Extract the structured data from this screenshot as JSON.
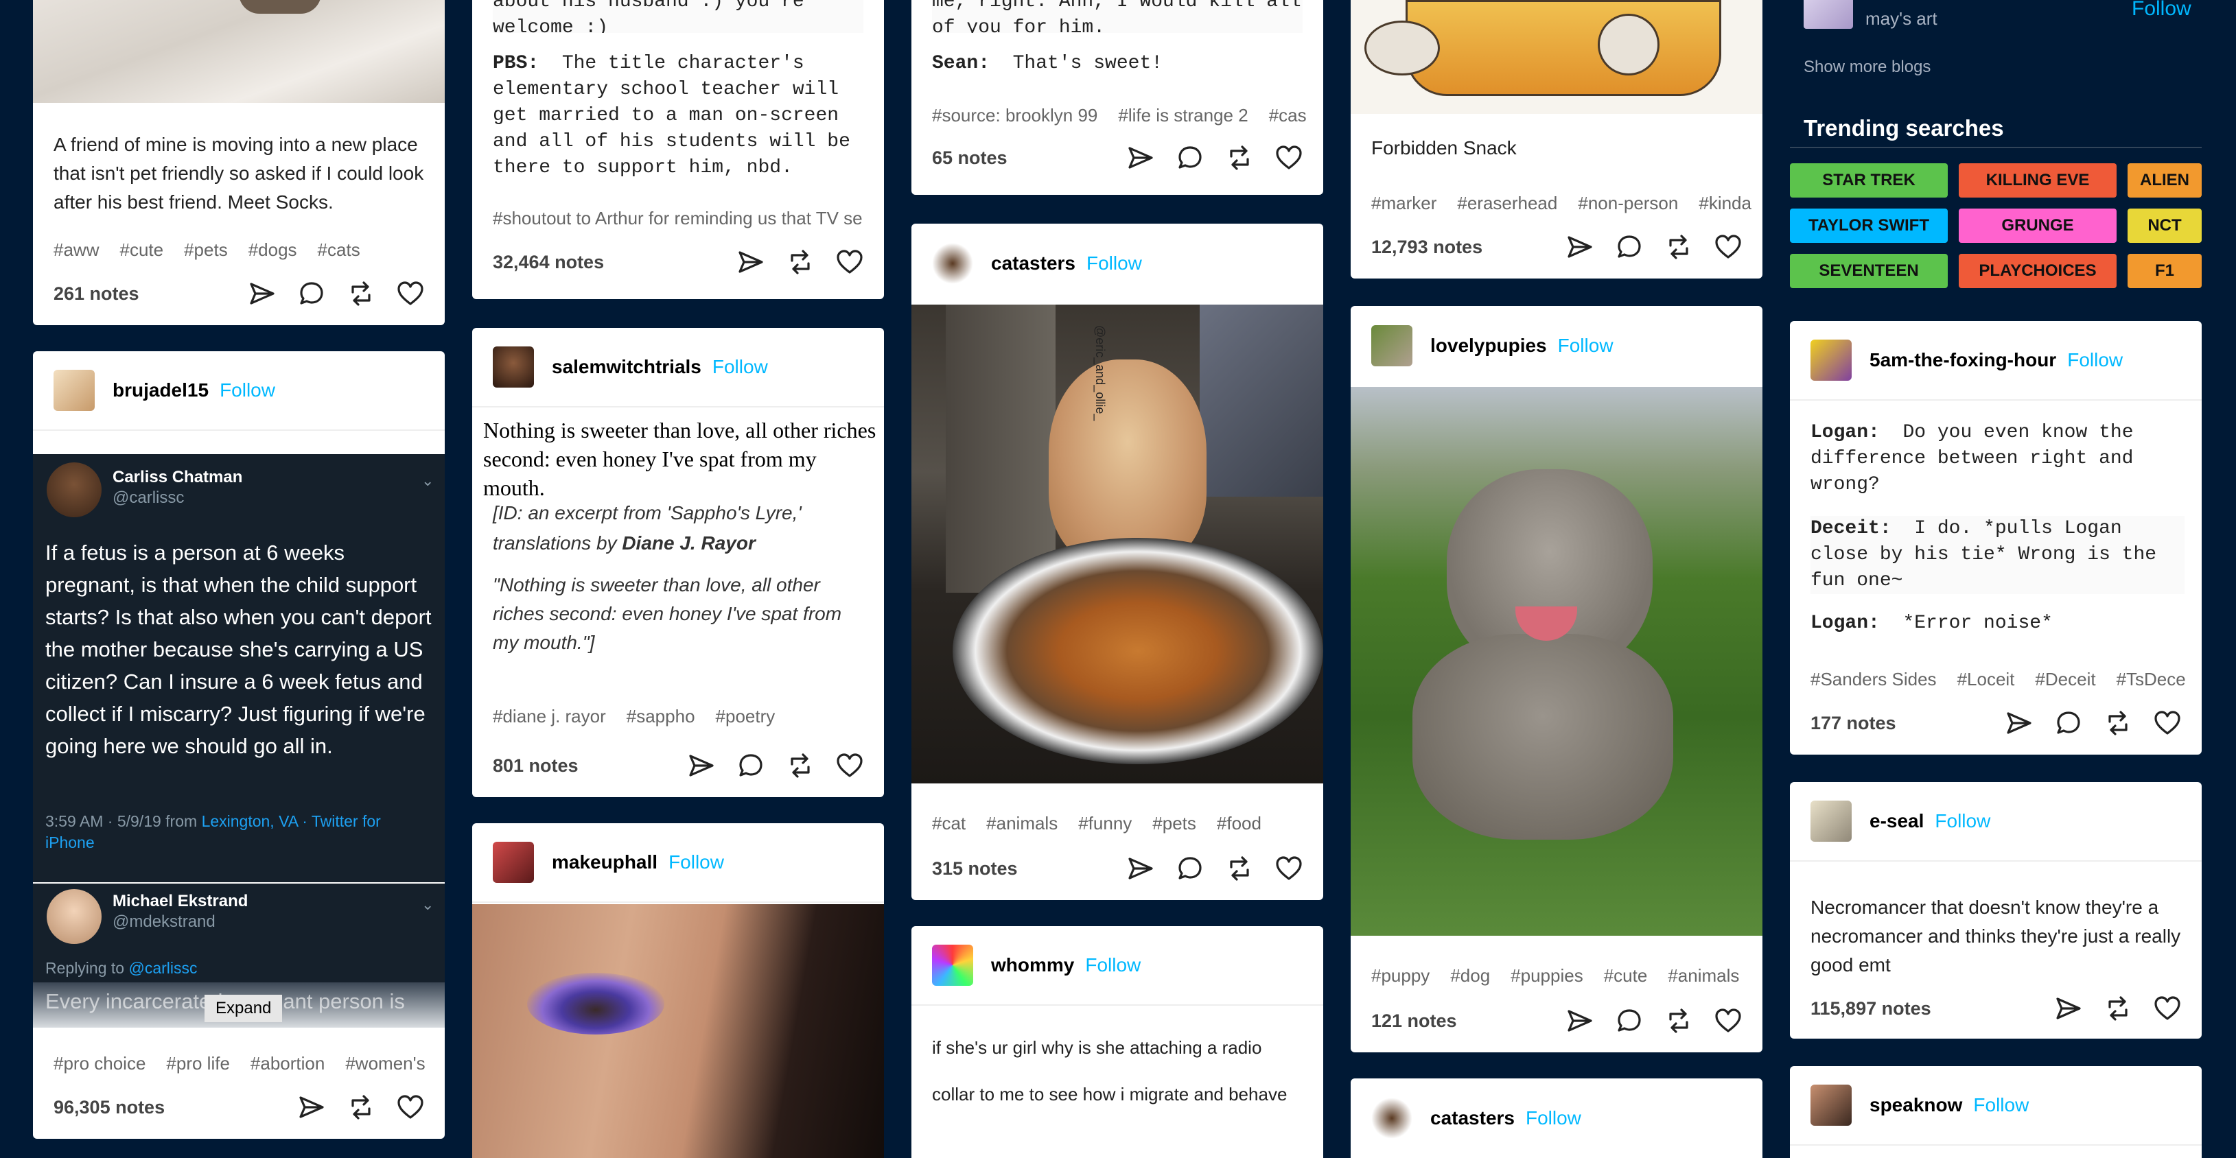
{
  "posts": {
    "socks": {
      "text": "A friend of mine is moving into a new place that isn't pet friendly so asked if I could look after his best friend. Meet Socks.",
      "tags": [
        "#aww",
        "#cute",
        "#pets",
        "#dogs",
        "#cats"
      ],
      "notes": "261 notes"
    },
    "brujadel": {
      "blog": "brujadel15",
      "follow": "Follow",
      "tweet1_name": "Carliss Chatman",
      "tweet1_handle": "@carlissc",
      "tweet1_text": "If a fetus is a person at 6 weeks pregnant, is that when the child support starts? Is that also when you can't deport the mother because she's carrying a US citizen? Can I insure a 6 week fetus and collect if I miscarry? Just figuring if we're going here we should go all in.",
      "tweet1_meta": "3:59 AM · 5/9/19 from",
      "tweet1_location": "Lexington, VA · Twitter for iPhone",
      "tweet2_name": "Michael Ekstrand",
      "tweet2_handle": "@mdekstrand",
      "replying": "Replying to",
      "replying_handle": "@carlissc",
      "tweet2_text": "Every incarcerated pregnant person is",
      "expand": "Expand",
      "tags": [
        "#pro choice",
        "#pro life",
        "#abortion",
        "#women's"
      ],
      "notes": "96,305 notes"
    },
    "pbs": {
      "top_text": "about his husband :) you're welcome :)",
      "label": "PBS:",
      "text": "The title character's elementary school teacher will get married to a man on-screen and all of his students will be there to support him, nbd.",
      "tags": [
        "#shoutout to Arthur for reminding us that TV se"
      ],
      "notes": "32,464 notes"
    },
    "salem": {
      "blog": "salemwitchtrials",
      "follow": "Follow",
      "poem": "Nothing is sweeter than love, all other riches second: even honey I've spat from my mouth.",
      "id_line": "[ID: an excerpt from 'Sappho's Lyre,' translations by",
      "id_author": "Diane J. Rayor",
      "quote": "\"Nothing is sweeter than love, all other riches second: even honey I've spat from my mouth.\"]",
      "tags": [
        "#diane j. rayor",
        "#sappho",
        "#poetry"
      ],
      "notes": "801 notes"
    },
    "makeup": {
      "blog": "makeuphall",
      "follow": "Follow"
    },
    "sean": {
      "top_text": "me, right. Ahh, I would kill all of you for him.",
      "label": "Sean:",
      "text": "That's sweet!",
      "tags": [
        "#source: brooklyn 99",
        "#life is strange 2",
        "#cas"
      ],
      "notes": "65 notes"
    },
    "catasters": {
      "blog": "catasters",
      "follow": "Follow",
      "watermark": "@eric_and_ollie_",
      "tags": [
        "#cat",
        "#animals",
        "#funny",
        "#pets",
        "#food"
      ],
      "notes": "315 notes"
    },
    "whommy": {
      "blog": "whommy",
      "follow": "Follow",
      "line1": "if she's ur girl why is she attaching a radio",
      "line2": "collar to me to see how i migrate and behave"
    },
    "snack": {
      "caption": "Forbidden Snack",
      "tags": [
        "#marker",
        "#eraserhead",
        "#non-person",
        "#kinda"
      ],
      "notes": "12,793 notes"
    },
    "lovelypupies": {
      "blog": "lovelypupies",
      "follow": "Follow",
      "tags": [
        "#puppy",
        "#dog",
        "#puppies",
        "#cute",
        "#animals"
      ],
      "notes": "121 notes"
    },
    "catasters2": {
      "blog": "catasters",
      "follow": "Follow"
    }
  },
  "sidebar": {
    "top_blog": "may's art",
    "top_follow": "Follow",
    "show_more": "Show more blogs",
    "trending_title": "Trending searches",
    "trending": [
      {
        "label": "STAR TREK",
        "color": "#5cc34c"
      },
      {
        "label": "KILLING EVE",
        "color": "#ef5a38"
      },
      {
        "label": "ALIEN",
        "color": "#f2992e"
      },
      {
        "label": "TAYLOR SWIFT",
        "color": "#00b8ff"
      },
      {
        "label": "GRUNGE",
        "color": "#ff62ce"
      },
      {
        "label": "NCT",
        "color": "#e8d738"
      },
      {
        "label": "SEVENTEEN",
        "color": "#5cc34c"
      },
      {
        "label": "PLAYCHOICES",
        "color": "#ef5a38"
      },
      {
        "label": "F1",
        "color": "#f2992e"
      }
    ],
    "foxing": {
      "blog": "5am-the-foxing-hour",
      "follow": "Follow",
      "l1_label": "Logan:",
      "l1_text": "Do you even know the difference between right and wrong?",
      "l2_label": "Deceit:",
      "l2_text": "I do. *pulls Logan close by his tie* Wrong is the fun one~",
      "l3_label": "Logan:",
      "l3_text": "*Error noise*",
      "tags": [
        "#Sanders Sides",
        "#Loceit",
        "#Deceit",
        "#TsDece"
      ],
      "notes": "177 notes"
    },
    "eseal": {
      "blog": "e-seal",
      "follow": "Follow",
      "text": "Necromancer that doesn't know they're a necromancer and thinks they're just a really good emt",
      "notes": "115,897 notes"
    },
    "speaknow": {
      "blog": "speaknow",
      "follow": "Follow"
    }
  }
}
